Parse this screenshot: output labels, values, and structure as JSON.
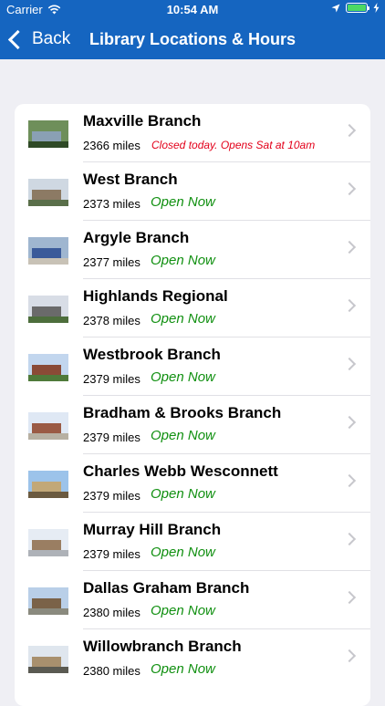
{
  "status_bar": {
    "carrier": "Carrier",
    "time": "10:54 AM",
    "icons": [
      "wifi-icon",
      "location-arrow-icon",
      "battery-icon",
      "charging-bolt-icon"
    ],
    "battery_color": "#4cd964"
  },
  "nav": {
    "back_label": "Back",
    "title": "Library Locations & Hours",
    "bar_color": "#1565c0"
  },
  "colors": {
    "open": "#119011",
    "closed": "#e3001a",
    "background": "#efeff4"
  },
  "branches": [
    {
      "name": "Maxville Branch",
      "distance": "2366 miles",
      "status": "Closed today. Opens Sat at 10am",
      "open": false
    },
    {
      "name": "West Branch",
      "distance": "2373 miles",
      "status": "Open Now",
      "open": true
    },
    {
      "name": "Argyle Branch",
      "distance": "2377 miles",
      "status": "Open Now",
      "open": true
    },
    {
      "name": "Highlands Regional",
      "distance": "2378 miles",
      "status": "Open Now",
      "open": true
    },
    {
      "name": "Westbrook Branch",
      "distance": "2379 miles",
      "status": "Open Now",
      "open": true
    },
    {
      "name": "Bradham & Brooks Branch",
      "distance": "2379 miles",
      "status": "Open Now",
      "open": true
    },
    {
      "name": "Charles Webb Wesconnett",
      "distance": "2379 miles",
      "status": "Open Now",
      "open": true
    },
    {
      "name": "Murray Hill Branch",
      "distance": "2379 miles",
      "status": "Open Now",
      "open": true
    },
    {
      "name": "Dallas Graham Branch",
      "distance": "2380 miles",
      "status": "Open Now",
      "open": true
    },
    {
      "name": "Willowbranch Branch",
      "distance": "2380 miles",
      "status": "Open Now",
      "open": true
    }
  ]
}
